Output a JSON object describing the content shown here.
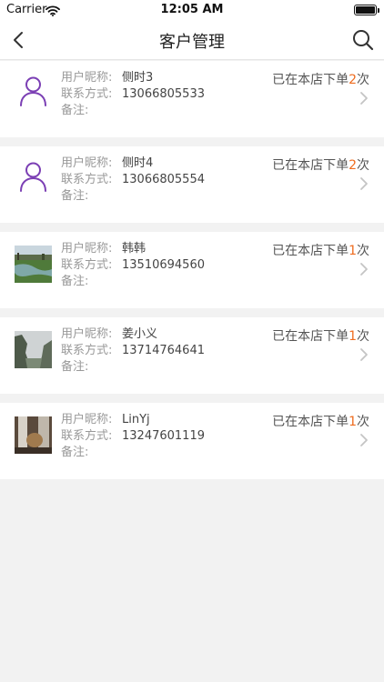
{
  "status_bar": {
    "carrier": "Carrier",
    "time": "12:05 AM"
  },
  "nav": {
    "title": "客户管理"
  },
  "labels": {
    "nickname": "用户昵称:",
    "contact": "联系方式:",
    "remark": "备注:"
  },
  "order_text": {
    "prefix": "已在本店下单",
    "suffix": "次"
  },
  "customers": [
    {
      "nickname": "侧时3",
      "phone": "13066805533",
      "remark": "",
      "orders": "2",
      "avatar": "person-icon"
    },
    {
      "nickname": "侧时4",
      "phone": "13066805554",
      "remark": "",
      "orders": "2",
      "avatar": "person-icon"
    },
    {
      "nickname": "韩韩",
      "phone": "13510694560",
      "remark": "",
      "orders": "1",
      "avatar": "photo-river"
    },
    {
      "nickname": "姜小义",
      "phone": "13714764641",
      "remark": "",
      "orders": "1",
      "avatar": "photo-cliff"
    },
    {
      "nickname": "LinYj",
      "phone": "13247601119",
      "remark": "",
      "orders": "1",
      "avatar": "photo-rock"
    }
  ],
  "colors": {
    "accent": "#ef6c1f",
    "person_icon": "#7b3fb4",
    "background": "#f2f2f2"
  }
}
